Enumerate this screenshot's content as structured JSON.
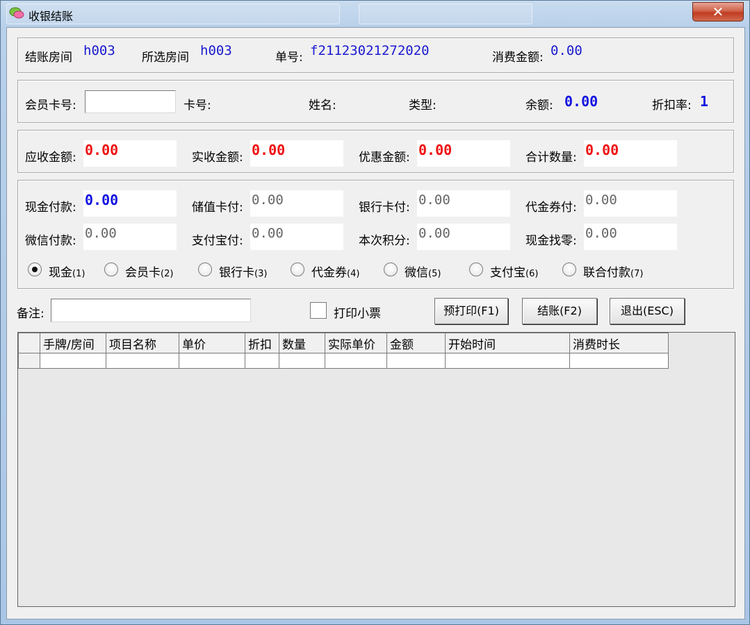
{
  "window": {
    "title": "收银结账",
    "close_label": "✕"
  },
  "summary": {
    "room_label": "结账房间",
    "room_value": "h003",
    "selected_label": "所选房间",
    "selected_value": "h003",
    "order_label": "单号:",
    "order_value": "f21123021272020",
    "amount_label": "消费金额:",
    "amount_value": "0.00"
  },
  "member": {
    "card_no_label": "会员卡号:",
    "card_no_value": "",
    "card_label": "卡号:",
    "name_label": "姓名:",
    "type_label": "类型:",
    "balance_label": "余额:",
    "balance_value": "0.00",
    "discount_label": "折扣率:",
    "discount_value": "1"
  },
  "totals": {
    "receivable_label": "应收金额:",
    "receivable_value": "0.00",
    "received_label": "实收金额:",
    "received_value": "0.00",
    "discount_amount_label": "优惠金额:",
    "discount_amount_value": "0.00",
    "qty_label": "合计数量:",
    "qty_value": "0.00"
  },
  "payments": {
    "cash_label": "现金付款:",
    "cash_value": "0.00",
    "stored_label": "储值卡付:",
    "stored_value": "0.00",
    "bank_label": "银行卡付:",
    "bank_value": "0.00",
    "voucher_label": "代金券付:",
    "voucher_value": "0.00",
    "wechat_label": "微信付款:",
    "wechat_value": "0.00",
    "alipay_label": "支付宝付:",
    "alipay_value": "0.00",
    "points_label": "本次积分:",
    "points_value": "0.00",
    "change_label": "现金找零:",
    "change_value": "0.00"
  },
  "pay_methods": [
    {
      "label": "现金",
      "key": "(1)",
      "selected": true
    },
    {
      "label": "会员卡",
      "key": "(2)",
      "selected": false
    },
    {
      "label": "银行卡",
      "key": "(3)",
      "selected": false
    },
    {
      "label": "代金券",
      "key": "(4)",
      "selected": false
    },
    {
      "label": "微信",
      "key": "(5)",
      "selected": false
    },
    {
      "label": "支付宝",
      "key": "(6)",
      "selected": false
    },
    {
      "label": "联合付款",
      "key": "(7)",
      "selected": false
    }
  ],
  "actions": {
    "remark_label": "备注:",
    "remark_value": "",
    "print_ticket_label": "打印小票",
    "preprint_label": "预打印(F1)",
    "checkout_label": "结账(F2)",
    "exit_label": "退出(ESC)"
  },
  "table": {
    "columns": [
      "手牌/房间",
      "项目名称",
      "单价",
      "折扣",
      "数量",
      "实际单价",
      "金额",
      "开始时间",
      "消费时长"
    ]
  },
  "colors": {
    "value_blue": "#1a1ad0",
    "value_red": "#ee1111",
    "close_red": "#c03c22"
  }
}
